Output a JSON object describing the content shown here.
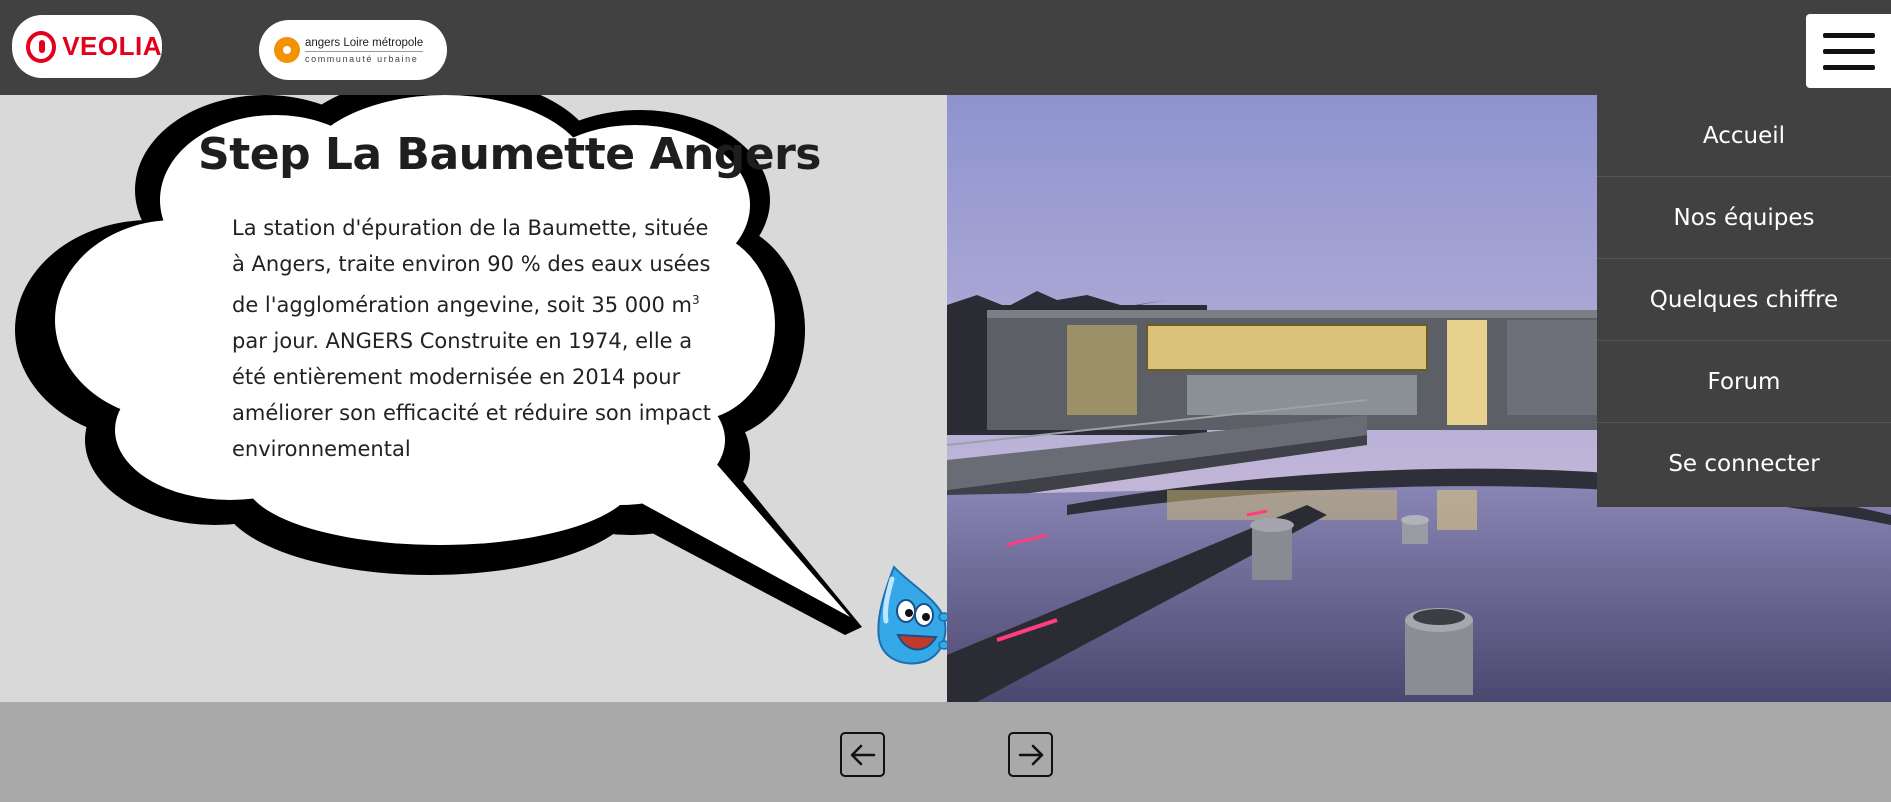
{
  "header": {
    "veolia_logo_text": "VEOLIA",
    "angers_logo_line1": "angers Loire métropole",
    "angers_logo_line2": "communauté urbaine",
    "menu_icon": "hamburger-menu-icon"
  },
  "hero": {
    "title": "Step La Baumette Angers",
    "description_part1": "La station d'épuration de la Baumette, située à Angers, traite environ 90 % des eaux usées de l'agglomération angevine, soit 35 000 m",
    "description_sup": "3",
    "description_part2": " par jour. ANGERS Construite en 1974, elle a été entièrement modernisée en 2014 pour améliorer son efficacité et réduire son impact environnemental"
  },
  "nav": {
    "items": [
      {
        "label": "Accueil"
      },
      {
        "label": "Nos équipes"
      },
      {
        "label": "Quelques chiffre"
      },
      {
        "label": "Forum"
      },
      {
        "label": "Se connecter"
      }
    ]
  },
  "footer": {
    "prev_icon": "arrow-left-icon",
    "next_icon": "arrow-right-icon"
  },
  "colors": {
    "header_bg": "#414141",
    "content_bg": "#d9d9d9",
    "footer_bg": "#a9a9a9",
    "veolia_red": "#e2001a",
    "angers_orange": "#f39200"
  }
}
